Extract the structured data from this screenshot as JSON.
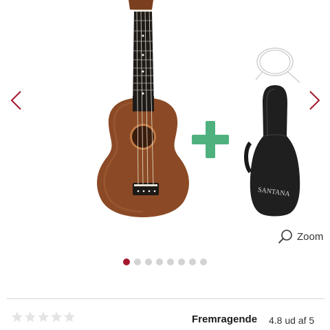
{
  "product": {
    "images_total": 8,
    "active_image": 1,
    "zoom_label": "Zoom",
    "logo_text": "SANTANA"
  },
  "rating": {
    "label": "Fremragende",
    "score_text": "4.8 ud af 5",
    "stars_total": 5
  },
  "colors": {
    "accent": "#a3172d",
    "plus": "#4fb27e",
    "dot_inactive": "#d3d3d3",
    "star_empty": "#e4e4e4"
  }
}
